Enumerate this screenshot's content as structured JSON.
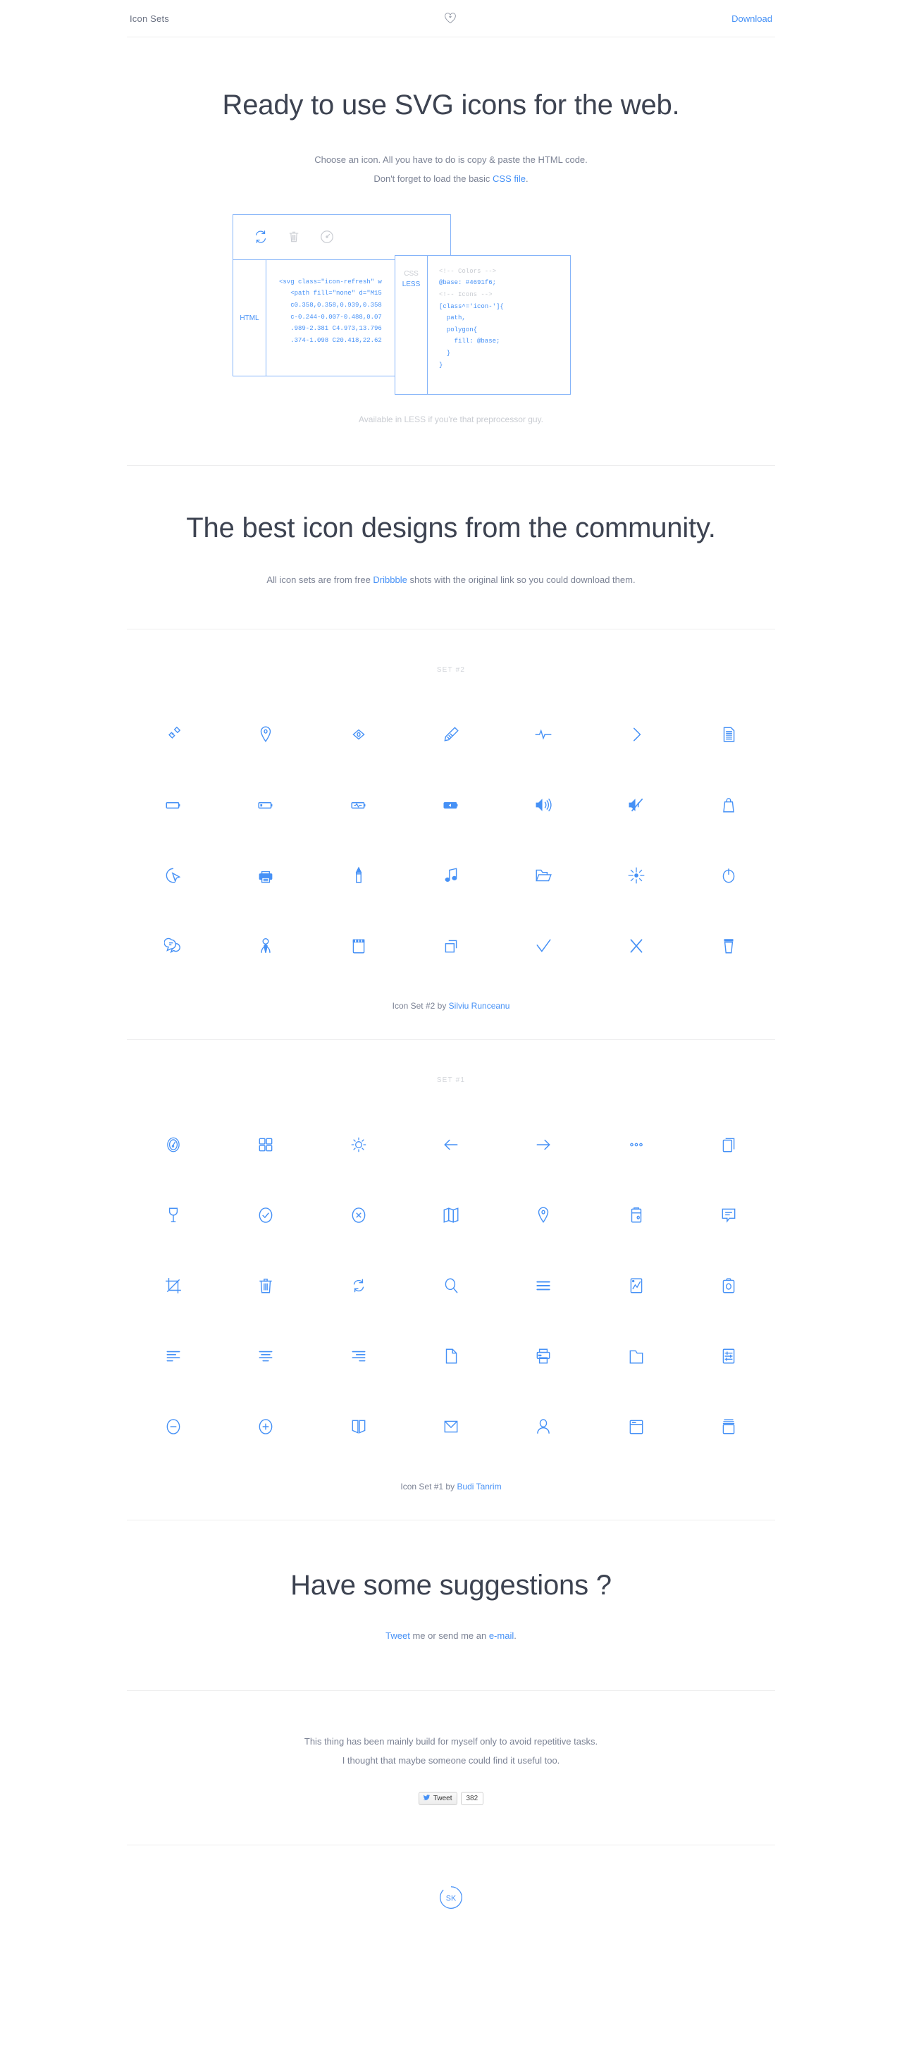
{
  "colors": {
    "accent": "#4691f6",
    "text": "#5b6374",
    "muted": "#c9ccd2",
    "rule": "#ededee"
  },
  "header": {
    "brand": "Icon Sets",
    "heart_icon": "heart-icon",
    "download_label": "Download"
  },
  "hero": {
    "title": "Ready to use SVG icons for the web.",
    "line1": "Choose an icon. All you have to do is copy & paste the HTML code.",
    "line2_pre": "Don't forget to load the basic ",
    "line2_link": "CSS file",
    "line2_post": ".",
    "note": "Available in LESS if you're that preprocessor guy."
  },
  "demo": {
    "preview_icons": [
      "refresh-icon",
      "trash-icon",
      "gauge-icon"
    ],
    "html_tab": "HTML",
    "html_code": "<svg class=\"icon-refresh\" w\n   <path fill=\"none\" d=\"M15\n   c0.358,0.358,0.939,0.358\n   c-0.244-0.007-0.488,0.07\n   .989-2.381 C4.973,13.796\n   .374-1.098 C20.418,22.62",
    "css_tab_top": "CSS",
    "css_tab_bottom": "LESS",
    "css_comment_colors": "<!-- Colors -->",
    "css_base_var": "@base: #4691f6;",
    "css_comment_icons": "<!-- Icons -->",
    "css_code": "[class^='icon-']{\n  path,\n  polygon{\n    fill: @base;\n  }\n}"
  },
  "community": {
    "title": "The best icon designs from the community.",
    "sub_pre": "All icon sets are from free ",
    "sub_link": "Dribbble",
    "sub_post": " shots with the original link so you could download them."
  },
  "sets": [
    {
      "label": "SET #2",
      "credit_pre": "Icon Set #2 by ",
      "credit_link": "Silviu Runceanu",
      "icons": [
        "link-icon",
        "map-pin-icon",
        "eye-icon",
        "pencil-icon",
        "pulse-icon",
        "chevron-right-icon",
        "document-lines-icon",
        "battery-empty-icon",
        "battery-low-icon",
        "battery-charging-icon",
        "battery-full-icon",
        "volume-up-icon",
        "volume-mute-icon",
        "shopping-bag-icon",
        "cursor-click-icon",
        "printer-icon",
        "marker-pen-icon",
        "music-note-icon",
        "folder-open-icon",
        "brightness-icon",
        "power-icon",
        "chat-bubbles-icon",
        "user-tie-icon",
        "notepad-icon",
        "copy-icon",
        "check-icon",
        "close-x-icon",
        "coffee-cup-icon"
      ]
    },
    {
      "label": "SET #1",
      "credit_pre": "Icon Set #1 by ",
      "credit_link": "Budi Tanrim",
      "icons": [
        "gauge-icon",
        "grid-icon",
        "sun-icon",
        "arrow-left-icon",
        "arrow-right-icon",
        "more-dots-icon",
        "layers-icon",
        "wine-glass-icon",
        "check-circle-icon",
        "x-circle-icon",
        "map-icon",
        "map-pin-icon",
        "camera-roll-icon",
        "chat-bubble-icon",
        "crop-icon",
        "trash-icon",
        "refresh-icon",
        "search-icon",
        "menu-icon",
        "chart-image-icon",
        "camera-icon",
        "align-left-icon",
        "align-center-icon",
        "align-right-icon",
        "file-icon",
        "printer-icon",
        "folder-icon",
        "sliders-icon",
        "minus-circle-icon",
        "plus-circle-icon",
        "book-icon",
        "envelope-icon",
        "user-icon",
        "browser-window-icon",
        "stack-icon"
      ]
    }
  ],
  "suggestions": {
    "title": "Have some suggestions ?",
    "link1": "Tweet",
    "mid": " me or send me an ",
    "link2": "e-mail",
    "end": "."
  },
  "outro": {
    "line1": "This thing has been mainly build for myself only to avoid repetitive tasks.",
    "line2": "I thought that maybe someone could find it useful too.",
    "tweet_label": "Tweet",
    "tweet_count": "382"
  },
  "footer": {
    "logo": "sk-logo-icon",
    "logo_text": "SK"
  }
}
